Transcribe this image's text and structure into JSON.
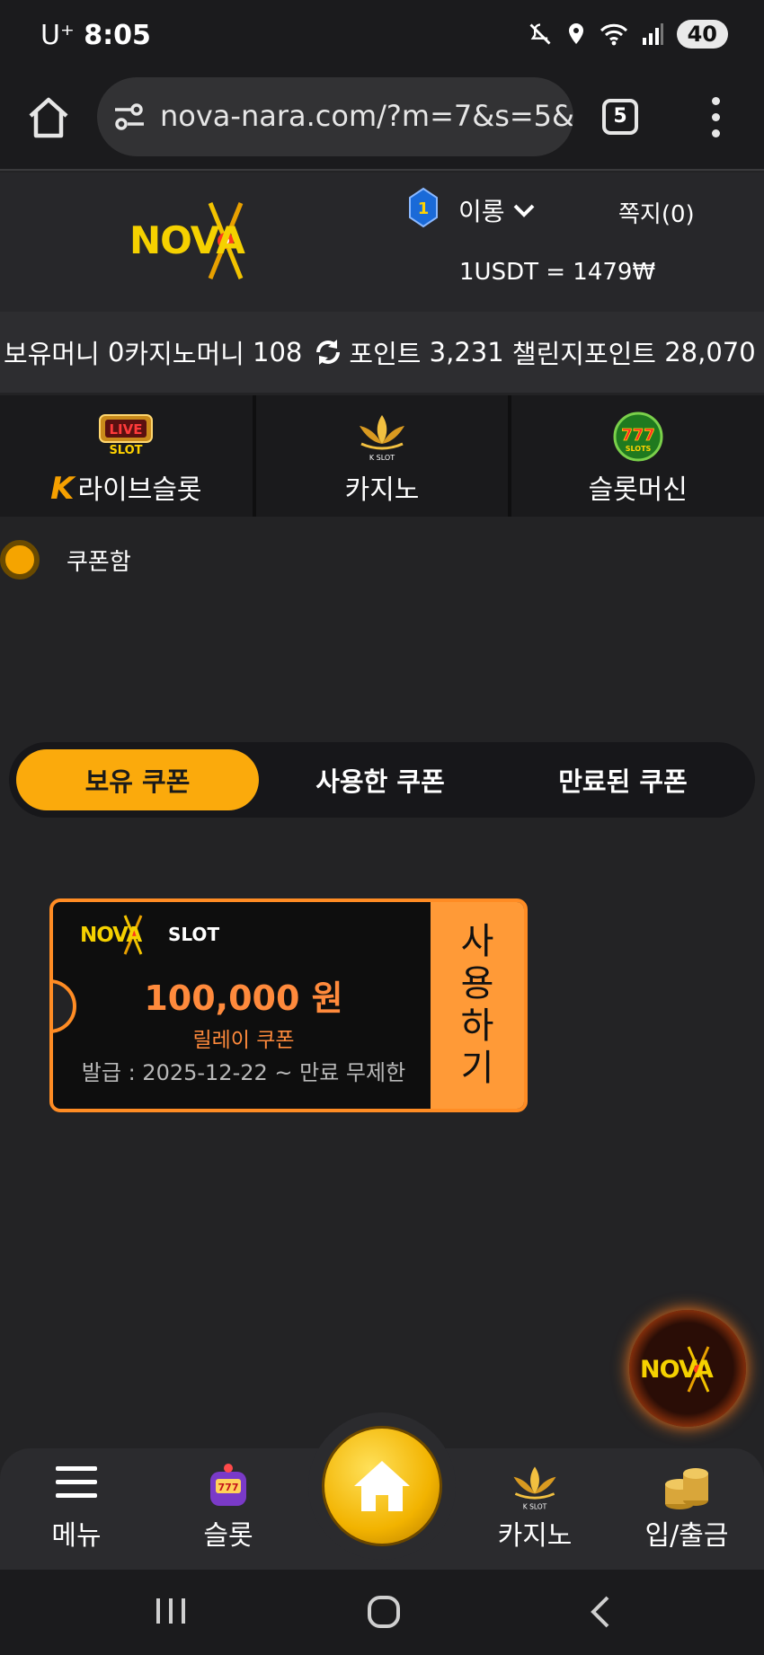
{
  "status": {
    "carrier": "U⁺",
    "time": "8:05",
    "battery": "40"
  },
  "browser": {
    "url": "nova-nara.com/?m=7&s=5&",
    "tab_count": "5"
  },
  "header": {
    "logo_text": "NOVA",
    "rank": "1",
    "user_name": "이롱",
    "messages": "쪽지(0)",
    "exchange_rate": "1USDT = 1479₩"
  },
  "balance": {
    "money_label": "보유머니",
    "money_value": "0",
    "casino_label": "카지노머니",
    "casino_value": "108",
    "point_label": "포인트",
    "point_value": "3,231",
    "challenge_label": "챌린지포인트",
    "challenge_value": "28,070"
  },
  "categories": [
    {
      "label": "라이브슬롯",
      "icon": "live-slot-icon",
      "badge": "LIVE",
      "sub": "SLOT"
    },
    {
      "label": "카지노",
      "icon": "k-slot-lotus-icon",
      "sub": "K SLOT"
    },
    {
      "label": "슬롯머신",
      "icon": "777-slots-icon",
      "badge": "777",
      "sub": "SLOTS"
    }
  ],
  "coupon_box": {
    "title": "쿠폰함"
  },
  "tabs": [
    {
      "label": "보유 쿠폰",
      "active": true
    },
    {
      "label": "사용한 쿠폰",
      "active": false
    },
    {
      "label": "만료된 쿠폰",
      "active": false
    }
  ],
  "coupon": {
    "brand": "NOVA",
    "brand_sub": "SLOT",
    "amount": "100,000 원",
    "type": "릴레이 쿠폰",
    "dates": "발급 : 2025-12-22 ~ 만료 무제한",
    "use_chars": [
      "사",
      "용",
      "하",
      "기"
    ]
  },
  "bottom_nav": {
    "menu": "메뉴",
    "slot": "슬롯",
    "casino": "카지노",
    "deposit": "입/출금",
    "casino_sub": "K SLOT"
  },
  "colors": {
    "accent": "#fbaa0c",
    "coupon_orange": "#ff8c24",
    "background": "#232325"
  }
}
